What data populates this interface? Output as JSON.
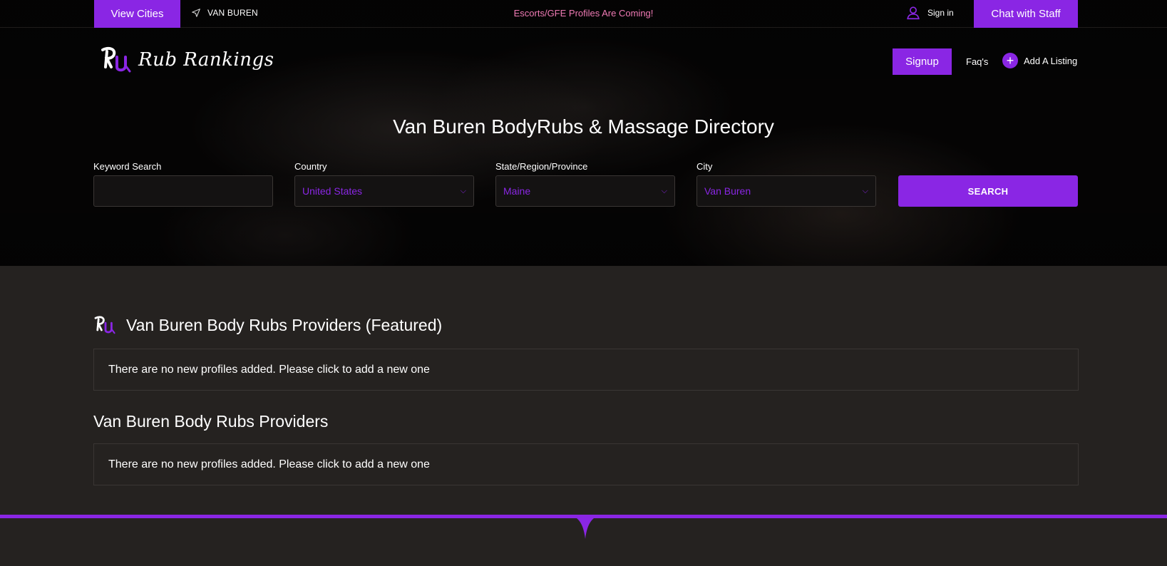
{
  "topbar": {
    "view_cities": "View Cities",
    "location": "VAN BUREN",
    "promo": "Escorts/GFE Profiles Are Coming!",
    "sign_in": "Sign in",
    "chat_staff": "Chat with Staff"
  },
  "header": {
    "logo_text": "Rub Rankings",
    "signup": "Signup",
    "faqs": "Faq's",
    "add_listing": "Add A Listing"
  },
  "hero": {
    "title": "Van Buren BodyRubs & Massage Directory"
  },
  "search": {
    "keyword_label": "Keyword Search",
    "keyword_value": "",
    "country_label": "Country",
    "country_value": "United States",
    "state_label": "State/Region/Province",
    "state_value": "Maine",
    "city_label": "City",
    "city_value": "Van Buren",
    "button": "SEARCH"
  },
  "sections": {
    "featured_title": "Van Buren Body Rubs Providers (Featured)",
    "featured_empty": "There are no new profiles added. Please click to add a new one",
    "providers_title": "Van Buren Body Rubs Providers",
    "providers_empty": "There are no new profiles added. Please click to add a new one"
  },
  "colors": {
    "accent": "#8a26e4",
    "promo": "#ef7ab4",
    "background": "#252220",
    "hero_bg": "#060505"
  },
  "icons": {
    "location": "navigation-arrow-icon",
    "user": "user-icon",
    "plus": "plus-icon",
    "chevron": "chevron-down-icon",
    "logo": "rr-logo-icon"
  }
}
